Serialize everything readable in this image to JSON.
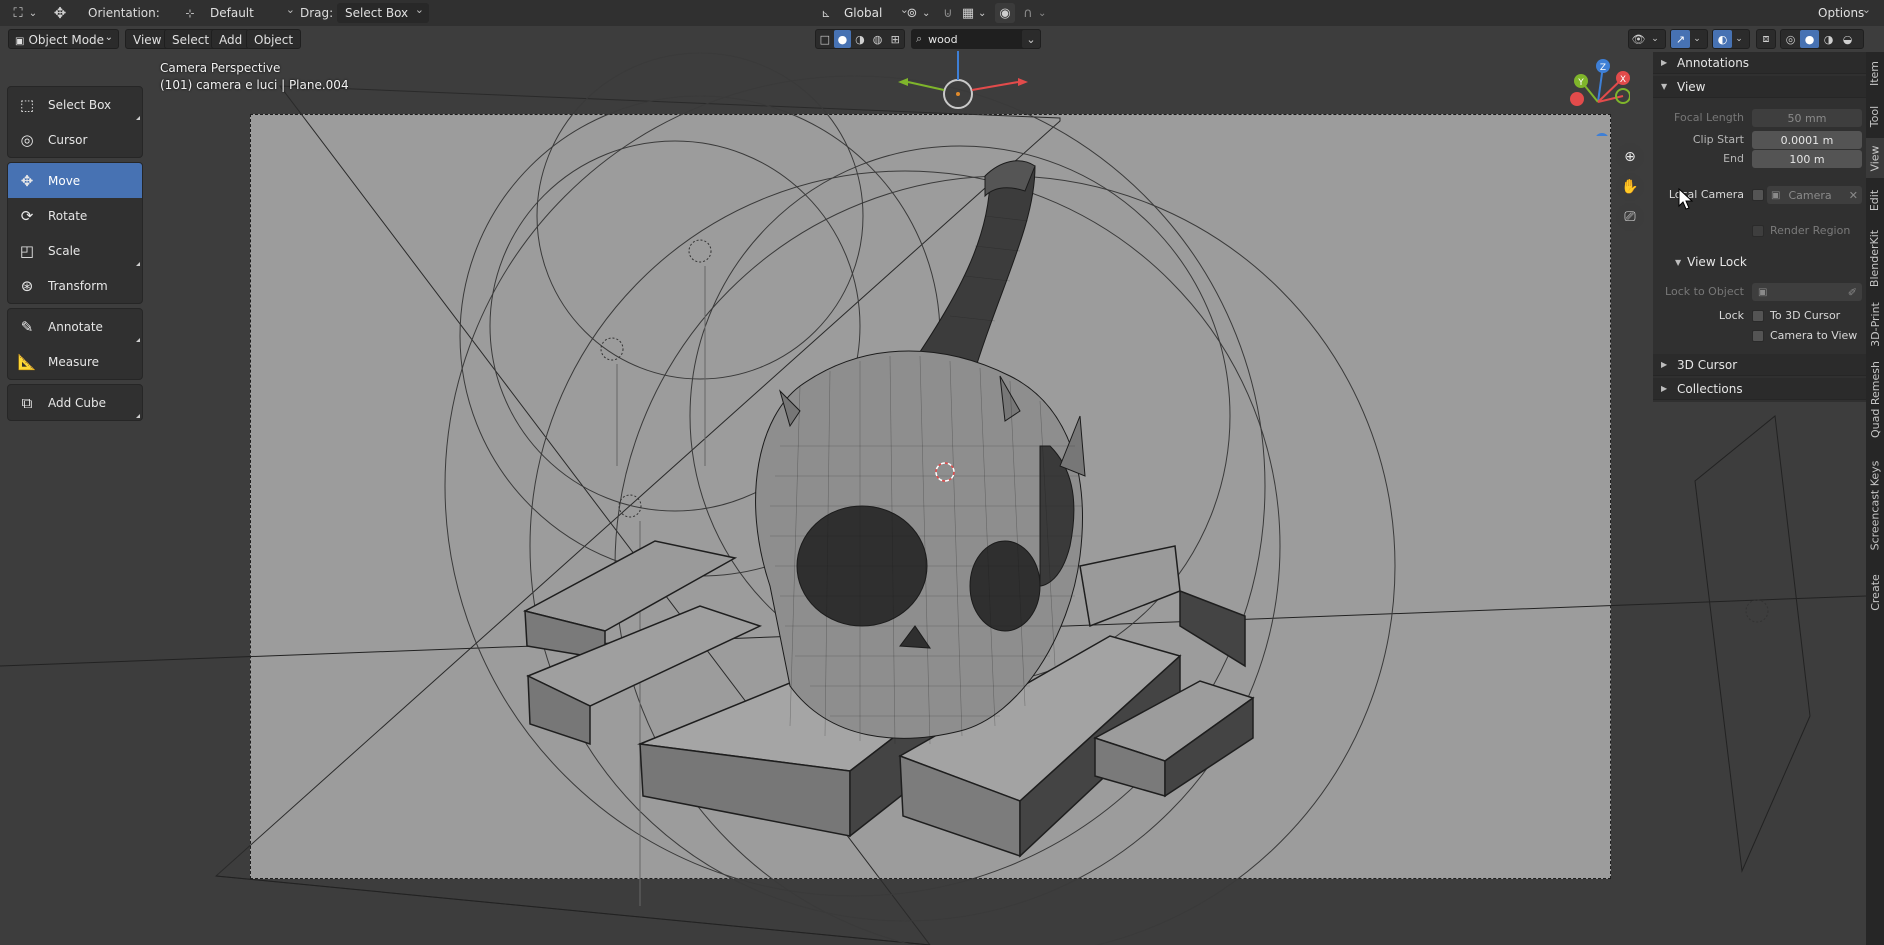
{
  "topbar": {
    "orientation_label": "Orientation:",
    "orientation_value": "Default",
    "drag_label": "Drag:",
    "drag_value": "Select Box",
    "transform_space": "Global",
    "options_label": "Options"
  },
  "header": {
    "mode": "Object Mode",
    "menus": [
      "View",
      "Select",
      "Add",
      "Object"
    ],
    "search_value": "wood"
  },
  "viewport": {
    "view_name": "Camera Perspective",
    "object_info": "(101) camera e luci | Plane.004",
    "gizmo_axes": {
      "x": "X",
      "y": "Y",
      "z": "Z"
    }
  },
  "tools": [
    {
      "label": "Select Box",
      "icon": "select-box-icon",
      "active": false
    },
    {
      "label": "Cursor",
      "icon": "cursor-icon",
      "active": false
    },
    {
      "label": "Move",
      "icon": "move-icon",
      "active": true
    },
    {
      "label": "Rotate",
      "icon": "rotate-icon",
      "active": false
    },
    {
      "label": "Scale",
      "icon": "scale-icon",
      "active": false
    },
    {
      "label": "Transform",
      "icon": "transform-icon",
      "active": false
    },
    {
      "label": "Annotate",
      "icon": "annotate-icon",
      "active": false
    },
    {
      "label": "Measure",
      "icon": "measure-icon",
      "active": false
    },
    {
      "label": "Add Cube",
      "icon": "add-cube-icon",
      "active": false
    }
  ],
  "npanel": {
    "annotations": "Annotations",
    "view": "View",
    "focal_length_label": "Focal Length",
    "focal_length_value": "50 mm",
    "clip_start_label": "Clip Start",
    "clip_start_value": "0.0001 m",
    "end_label": "End",
    "end_value": "100 m",
    "local_camera_label": "Local Camera",
    "local_camera_value": "Camera",
    "render_region": "Render Region",
    "view_lock": "View Lock",
    "lock_to_object_label": "Lock to Object",
    "lock_label": "Lock",
    "to_3d_cursor": "To 3D Cursor",
    "camera_to_view": "Camera to View",
    "cursor_3d": "3D Cursor",
    "collections": "Collections"
  },
  "side_tabs": [
    "Item",
    "Tool",
    "View",
    "Edit",
    "BlenderKit",
    "3D-Print",
    "Quad Remesh",
    "Screencast Keys",
    "Create"
  ],
  "colors": {
    "active_blue": "#4772b3",
    "axis_x": "#e24b4b",
    "axis_y": "#7fb52b",
    "axis_z": "#3e7fd6"
  }
}
